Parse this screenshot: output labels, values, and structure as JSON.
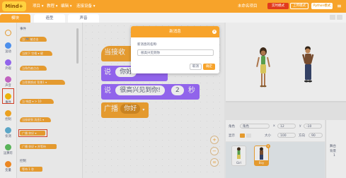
{
  "topbar": {
    "logo": "Mind+",
    "menus": [
      "项目 ▾",
      "教程 ▾",
      "编辑 ▾",
      "连接设备 ▾"
    ],
    "right_title": "未命名项目",
    "realtime": "实时模式",
    "upload": "上传模式",
    "python": "Python模式",
    "menu_icon": "≡"
  },
  "tabs": {
    "code": "模块",
    "costume": "造型",
    "sound": "声音"
  },
  "categories": [
    {
      "label": "",
      "color": "#ffffff"
    },
    {
      "label": "运动",
      "color": "#4c97ff"
    },
    {
      "label": "外观",
      "color": "#9966ff"
    },
    {
      "label": "声音",
      "color": "#cf63cf"
    },
    {
      "label": "事件",
      "color": "#ffbf00"
    },
    {
      "label": "控制",
      "color": "#ffab19"
    },
    {
      "label": "侦测",
      "color": "#5cb1d6"
    },
    {
      "label": "运算符",
      "color": "#59c059"
    },
    {
      "label": "变量",
      "color": "#ff8c1a"
    }
  ],
  "palette": {
    "section_events": "事件",
    "blocks": [
      "当 🏁 被点击",
      "当按下 空格 ▾ 键",
      "当角色被点击",
      "当背景换成 背景1 ▾",
      "当 响度 ▾ > 10",
      "当接收到 消息1 ▾",
      "广播 你好 ▾",
      "广播 你好 ▾ 并等待"
    ],
    "section_control": "控制",
    "wait_block": "等待 1 秒"
  },
  "script": {
    "hat": "当接收",
    "say1": "说",
    "say1_value": "你好",
    "say2": "说",
    "say2_value": "很高兴见到你!",
    "say2_secs": "2",
    "say2_unit": "秒",
    "broadcast": "广播",
    "broadcast_value": "你好",
    "zoom_in": "+",
    "zoom_out": "−",
    "zoom_reset": "="
  },
  "modal": {
    "title": "新消息",
    "close": "×",
    "prompt": "新消息的名称:",
    "input_value": "很高兴见到你",
    "cancel": "取消",
    "ok": "确定"
  },
  "sprite_info": {
    "sprite_label": "角色",
    "sprite_name": "角色",
    "x_label": "x",
    "x_value": "12",
    "y_label": "y",
    "y_value": "-10",
    "show_label": "显示",
    "size_label": "大小",
    "size_value": "100",
    "direction_label": "方向",
    "direction_value": "90"
  },
  "sprites": [
    {
      "name": "Girl"
    },
    {
      "name": "Boy"
    }
  ],
  "stage_panel": {
    "label": "舞台",
    "backdrops": "背景",
    "count": "1"
  }
}
